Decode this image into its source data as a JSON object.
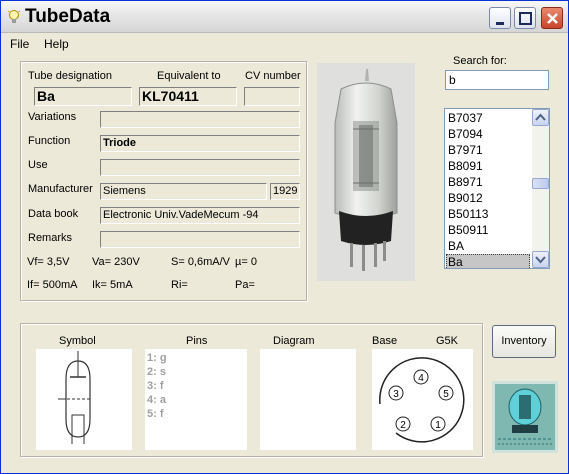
{
  "window": {
    "title": "TubeData"
  },
  "menu": {
    "file": "File",
    "help": "Help"
  },
  "details": {
    "headers": {
      "designation": "Tube designation",
      "equivalent": "Equivalent to",
      "cv": "CV number"
    },
    "designation": "Ba",
    "equivalent": "KL70411",
    "cv": "",
    "labels": {
      "variations": "Variations",
      "function": "Function",
      "use": "Use",
      "manufacturer": "Manufacturer",
      "databook": "Data book",
      "remarks": "Remarks"
    },
    "variations": "",
    "function": "Triode",
    "use": "",
    "manufacturer": "Siemens",
    "year": "1929",
    "databook": "Electronic Univ.VadeMecum -94",
    "remarks": ""
  },
  "params": {
    "vf": "Vf= 3,5V",
    "va": "Va= 230V",
    "s": "S= 0,6mA/V",
    "mu": "µ=   0",
    "if": "If= 500mA",
    "ik": "Ik=  5mA",
    "ri": "Ri=",
    "pa": "Pa="
  },
  "search": {
    "label": "Search for:",
    "value": "b"
  },
  "tube_list": [
    {
      "name": "B7037",
      "selected": false
    },
    {
      "name": "B7094",
      "selected": false
    },
    {
      "name": "B7971",
      "selected": false
    },
    {
      "name": "B8091",
      "selected": false
    },
    {
      "name": "B8971",
      "selected": false
    },
    {
      "name": "B9012",
      "selected": false
    },
    {
      "name": "B50113",
      "selected": false
    },
    {
      "name": "B50911",
      "selected": false
    },
    {
      "name": "BA",
      "selected": false
    },
    {
      "name": "Ba",
      "selected": true
    }
  ],
  "bottom": {
    "symbol": "Symbol",
    "pins": "Pins",
    "diagram": "Diagram",
    "base": "Base",
    "base_type": "G5K",
    "pin_list": [
      "1: g",
      "2: s",
      "3: f",
      "4: a",
      "5: f"
    ],
    "base_pins": [
      "1",
      "2",
      "3",
      "4",
      "5"
    ]
  },
  "buttons": {
    "inventory": "Inventory"
  }
}
